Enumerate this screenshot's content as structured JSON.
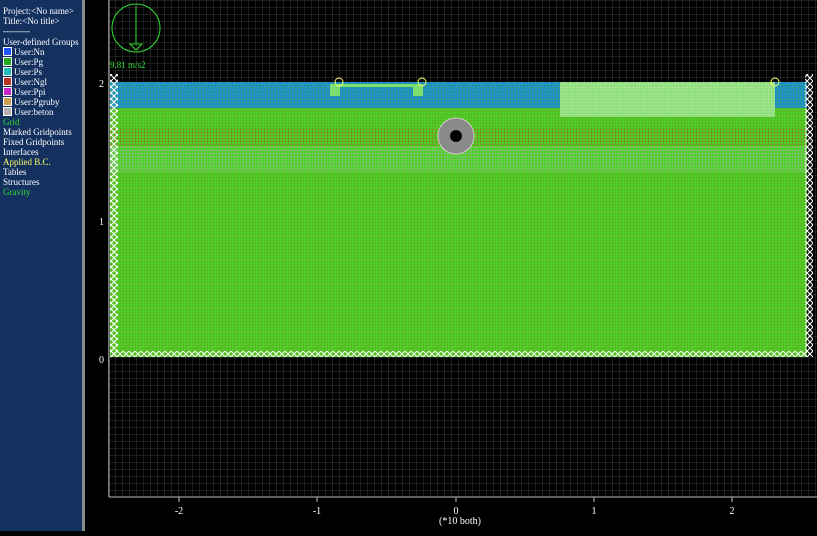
{
  "legend": {
    "project": "Project:<No name>",
    "title": "Title:<No title>",
    "separator": "---------",
    "groups_header": "User-defined Groups",
    "groups": [
      {
        "label": "User:Nn",
        "color": "#2255ff"
      },
      {
        "label": "User:Pg",
        "color": "#22aa22"
      },
      {
        "label": "User:Ps",
        "color": "#22bbbb"
      },
      {
        "label": "User:Ngl",
        "color": "#bb3322"
      },
      {
        "label": "User:Ppi",
        "color": "#cc22cc"
      },
      {
        "label": "User:Pgruby",
        "color": "#c8a050"
      },
      {
        "label": "User:beton",
        "color": "#b0b0b0"
      }
    ],
    "items": [
      {
        "label": "Grid",
        "color": "#33dd33"
      },
      {
        "label": "Marked Gridpoints",
        "color": "#ffffff"
      },
      {
        "label": "Fixed Gridpoints",
        "color": "#ffffff"
      },
      {
        "label": "Interfaces",
        "color": "#ffffff"
      },
      {
        "label": "Applied B.C.",
        "color": "#ffff66"
      },
      {
        "label": "Tables",
        "color": "#ffffff"
      },
      {
        "label": "Structures",
        "color": "#ffffff"
      },
      {
        "label": "Gravity",
        "color": "#33dd33"
      }
    ]
  },
  "gravity": {
    "label": "9.81 m/s2",
    "icon": "gravity-arrow-icon"
  },
  "axes": {
    "x_ticks": [
      "-2",
      "-1",
      "0",
      "1",
      "2"
    ],
    "y_ticks": [
      "0",
      "1",
      "2"
    ],
    "caption": "(*10 both)"
  },
  "colors": {
    "background": "#000000",
    "grid_green": "#44cc22",
    "mesh_blue": "#1e8ccc"
  }
}
